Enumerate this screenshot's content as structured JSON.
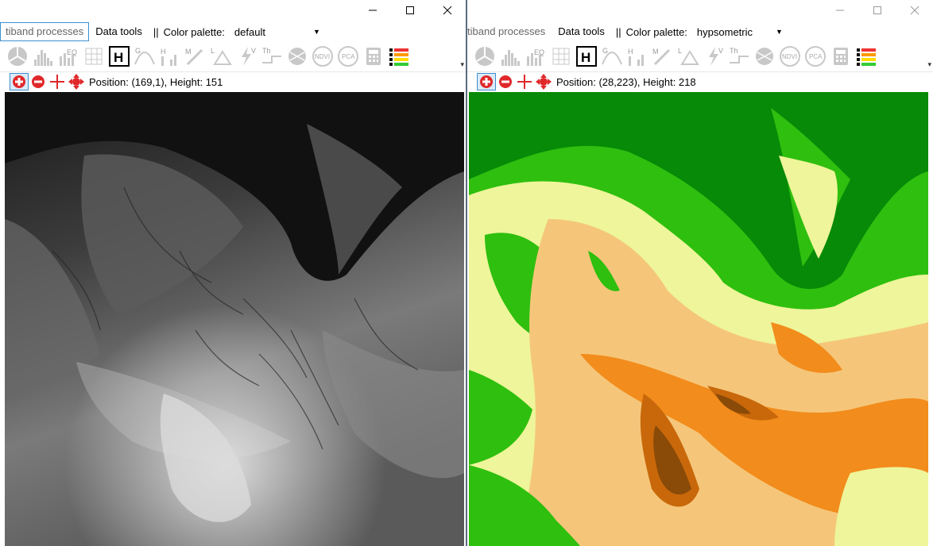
{
  "left_window": {
    "menu": {
      "multiband_processes": "tiband processes",
      "data_tools": "Data tools",
      "separator": "||",
      "color_palette_label": "Color palette:",
      "color_palette_value": "default"
    },
    "toolbar": {
      "icons": [
        "pie-chart-icon",
        "histogram-icon",
        "equalize-icon",
        "grid-icon",
        "h-icon",
        "gaussian-icon",
        "threshold-histogram-icon",
        "magic-wand-icon",
        "triangle-icon",
        "lightning-icon",
        "threshold-step-icon",
        "globe-icon",
        "ndvi-icon",
        "pca-icon",
        "calculator-icon",
        "color-ramp-icon"
      ],
      "ndvi": "NDVI",
      "pca": "PCA"
    },
    "info": {
      "position_text": "Position: (169,1), Height: 151"
    },
    "image": {
      "palette": "grayscale"
    }
  },
  "right_window": {
    "menu": {
      "multiband_processes": "tiband processes",
      "data_tools": "Data tools",
      "separator": "||",
      "color_palette_label": "Color palette:",
      "color_palette_value": "hypsometric"
    },
    "toolbar": {
      "ndvi": "NDVI",
      "pca": "PCA"
    },
    "info": {
      "position_text": "Position: (28,223), Height: 218"
    },
    "image": {
      "palette": "hypsometric"
    }
  },
  "colors": {
    "accent": "#3c8fd0",
    "nav_red": "#e0282a",
    "hyp_dark_green": "#078a07",
    "hyp_green": "#2fbf0f",
    "hyp_light_green": "#eef59a",
    "hyp_tan": "#f5c67a",
    "hyp_orange": "#f28c1c",
    "hyp_brown": "#8a4a08"
  }
}
